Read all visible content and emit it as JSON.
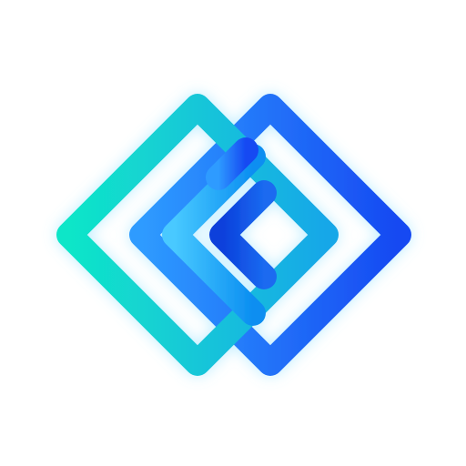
{
  "logo": {
    "colors": {
      "background": "#FFFFFF",
      "left_start": "#10E6C8",
      "left_end": "#18A7E8",
      "mid_start": "#48C9FF",
      "mid_end": "#0B8EF1",
      "right_start": "#2E9BFF",
      "right_end": "#1649F2",
      "inner_start": "#0B3FDB",
      "inner_end": "#1A6AF0",
      "glow": "#6FD7FF"
    }
  }
}
